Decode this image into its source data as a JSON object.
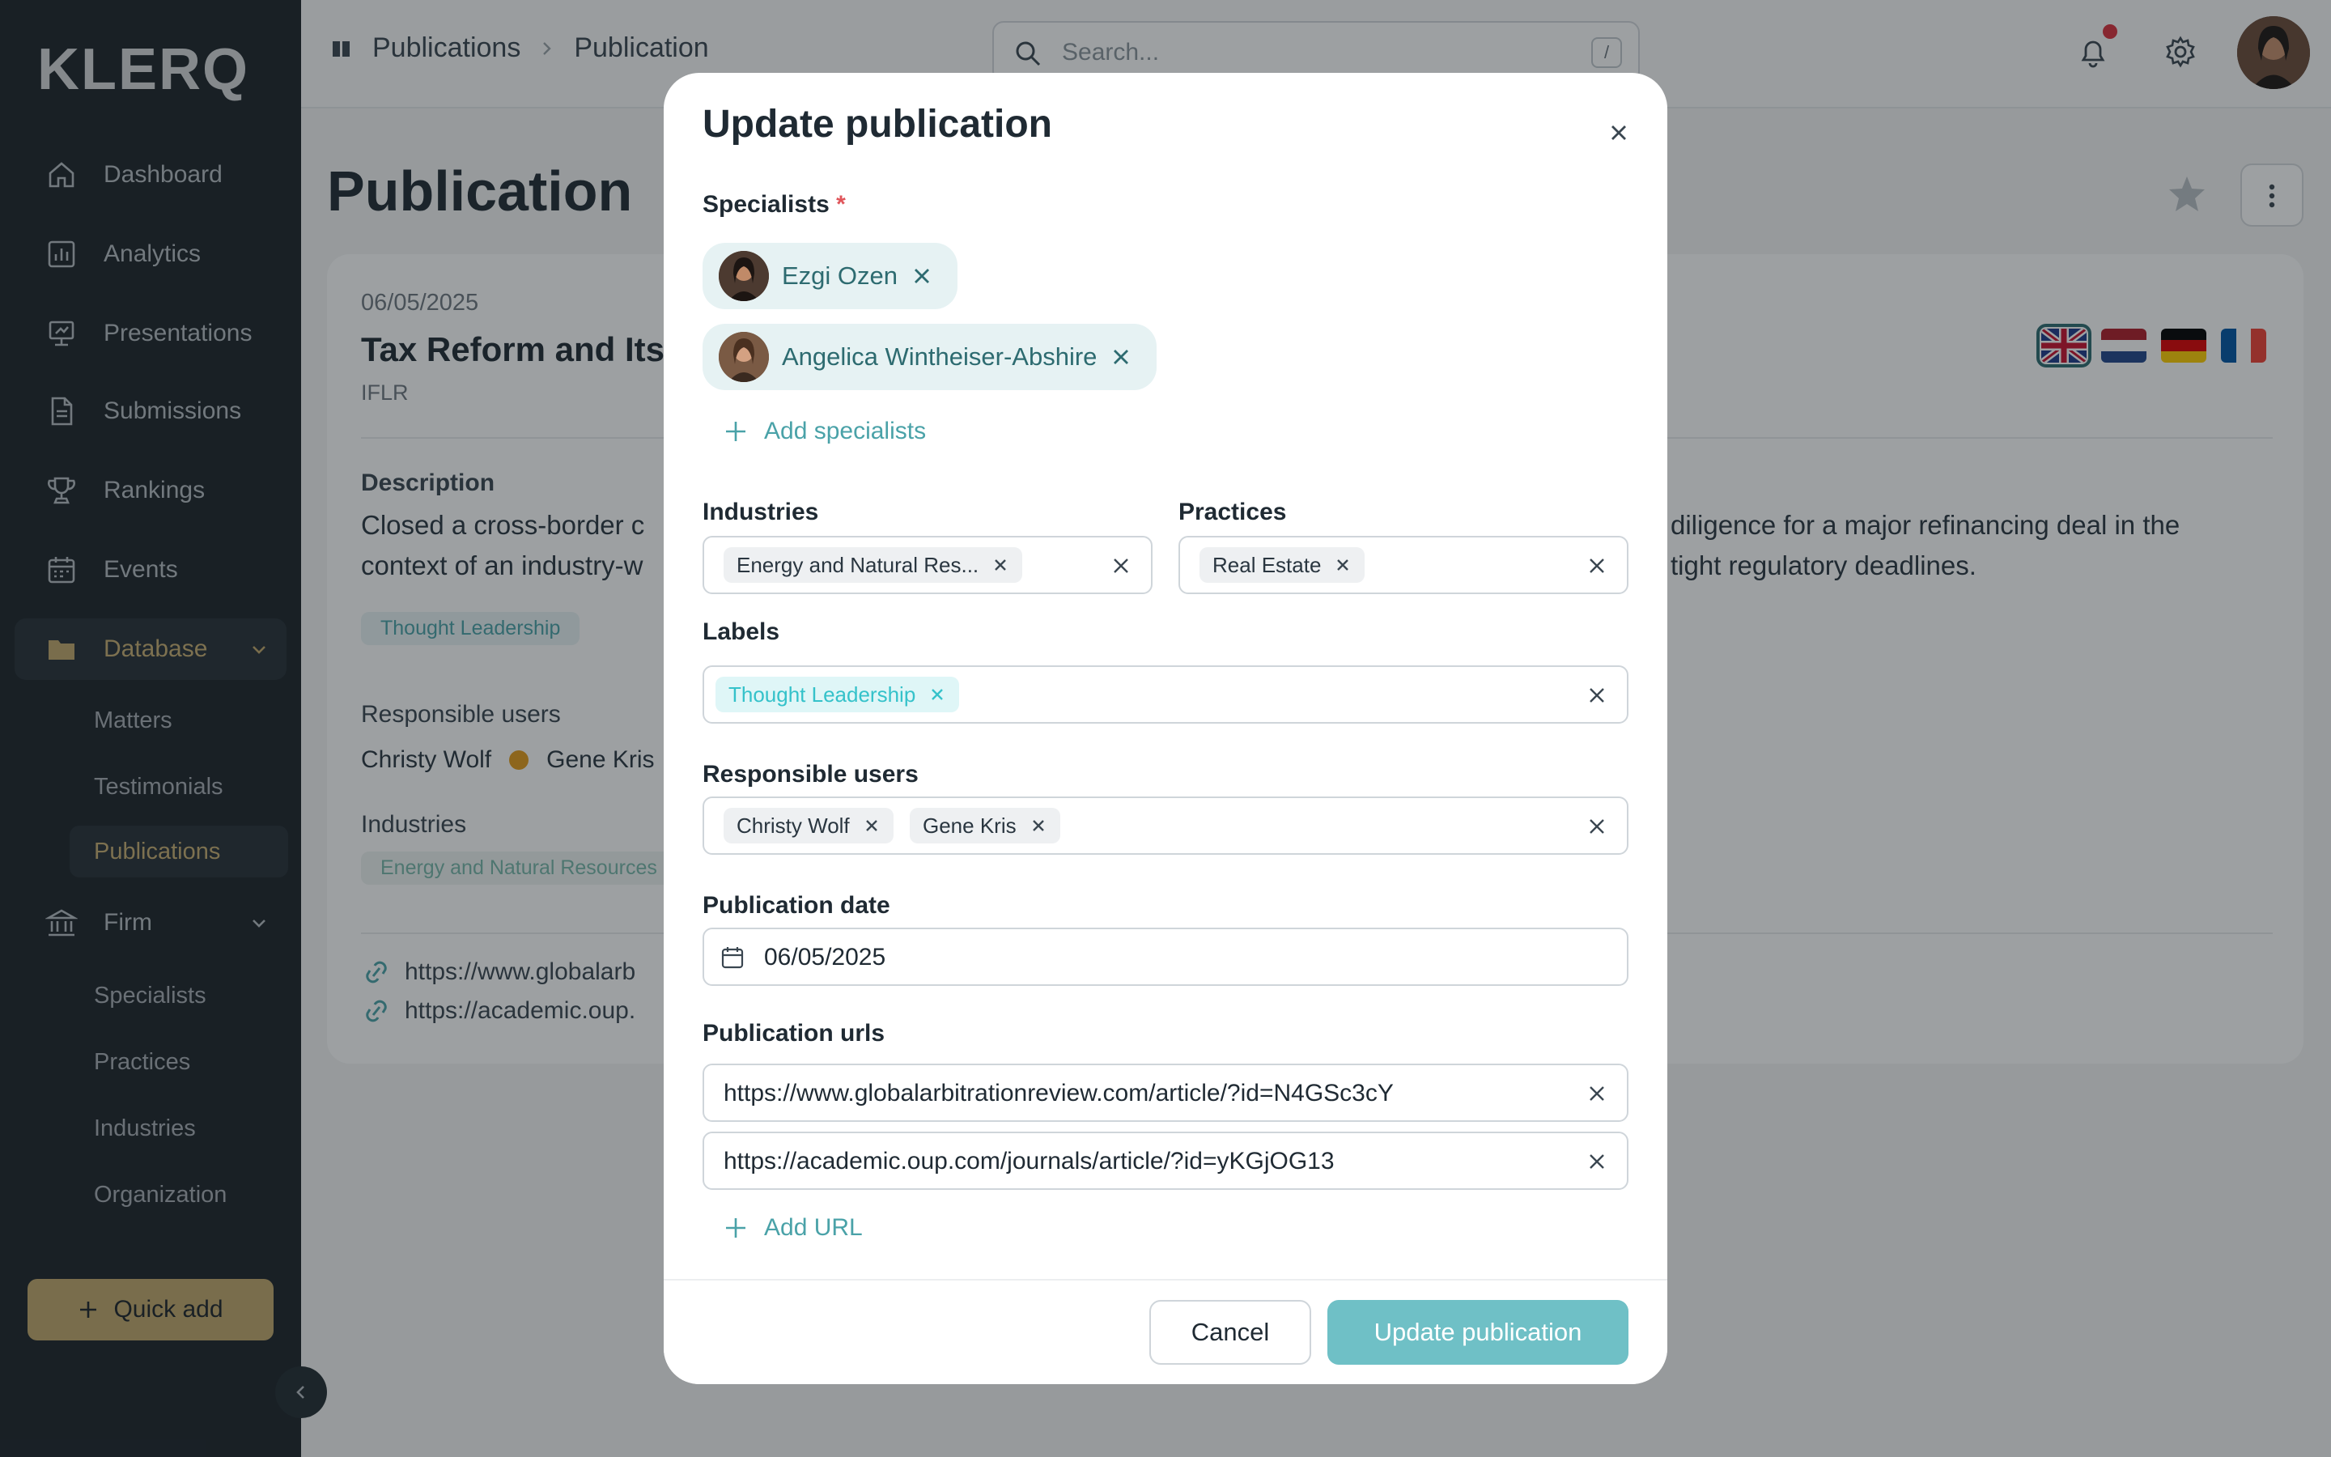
{
  "app": {
    "logo": "KLERQ"
  },
  "sidebar": {
    "items": [
      {
        "label": "Dashboard",
        "icon": "home-icon"
      },
      {
        "label": "Analytics",
        "icon": "bar-chart-icon"
      },
      {
        "label": "Presentations",
        "icon": "presentation-icon"
      },
      {
        "label": "Submissions",
        "icon": "document-icon"
      },
      {
        "label": "Rankings",
        "icon": "trophy-icon"
      },
      {
        "label": "Events",
        "icon": "calendar-icon"
      },
      {
        "label": "Database",
        "icon": "folder-icon",
        "expanded": true
      },
      {
        "label": "Firm",
        "icon": "bank-icon",
        "expanded": true
      }
    ],
    "database_sub": [
      "Matters",
      "Testimonials",
      "Publications"
    ],
    "firm_sub": [
      "Specialists",
      "Practices",
      "Industries",
      "Organization"
    ],
    "quick_add": "Quick add",
    "accent": "#c2a86b"
  },
  "topbar": {
    "breadcrumb": [
      "Publications",
      "Publication"
    ],
    "search_placeholder": "Search...",
    "search_shortcut": "/"
  },
  "page": {
    "title": "Publication",
    "date": "06/05/2025",
    "pub_title": "Tax Reform and Its",
    "source": "IFLR",
    "description_label": "Description",
    "description_left_1": "Closed a cross-border c",
    "description_left_2": "context of an industry-w",
    "description_right_1": "diligence for a major refinancing deal in the",
    "description_right_2": "tight regulatory deadlines.",
    "label_chip": "Thought Leadership",
    "responsible_label": "Responsible users",
    "users": [
      "Christy Wolf",
      "Gene Kris"
    ],
    "industries_label": "Industries",
    "industry_chip": "Energy and Natural Resources",
    "url_1": "https://www.globalarb",
    "url_2": "https://academic.oup.",
    "flags": [
      "uk-flag",
      "nl-flag",
      "de-flag",
      "fr-flag"
    ]
  },
  "modal": {
    "title": "Update publication",
    "specialists_label": "Specialists",
    "required_mark": "*",
    "specialists": [
      "Ezgi Ozen",
      "Angelica Wintheiser-Abshire"
    ],
    "add_specialists": "Add specialists",
    "industries_label": "Industries",
    "industries": [
      "Energy and Natural Res..."
    ],
    "practices_label": "Practices",
    "practices": [
      "Real Estate"
    ],
    "labels_label": "Labels",
    "labels": [
      "Thought Leadership"
    ],
    "responsible_label": "Responsible users",
    "responsible": [
      "Christy Wolf",
      "Gene Kris"
    ],
    "date_label": "Publication date",
    "date_value": "06/05/2025",
    "urls_label": "Publication urls",
    "urls": [
      "https://www.globalarbitrationreview.com/article/?id=N4GSc3cY",
      "https://academic.oup.com/journals/article/?id=yKGjOG13"
    ],
    "add_url": "Add URL",
    "cancel": "Cancel",
    "submit": "Update publication",
    "submit_color": "#6fc0c6"
  }
}
